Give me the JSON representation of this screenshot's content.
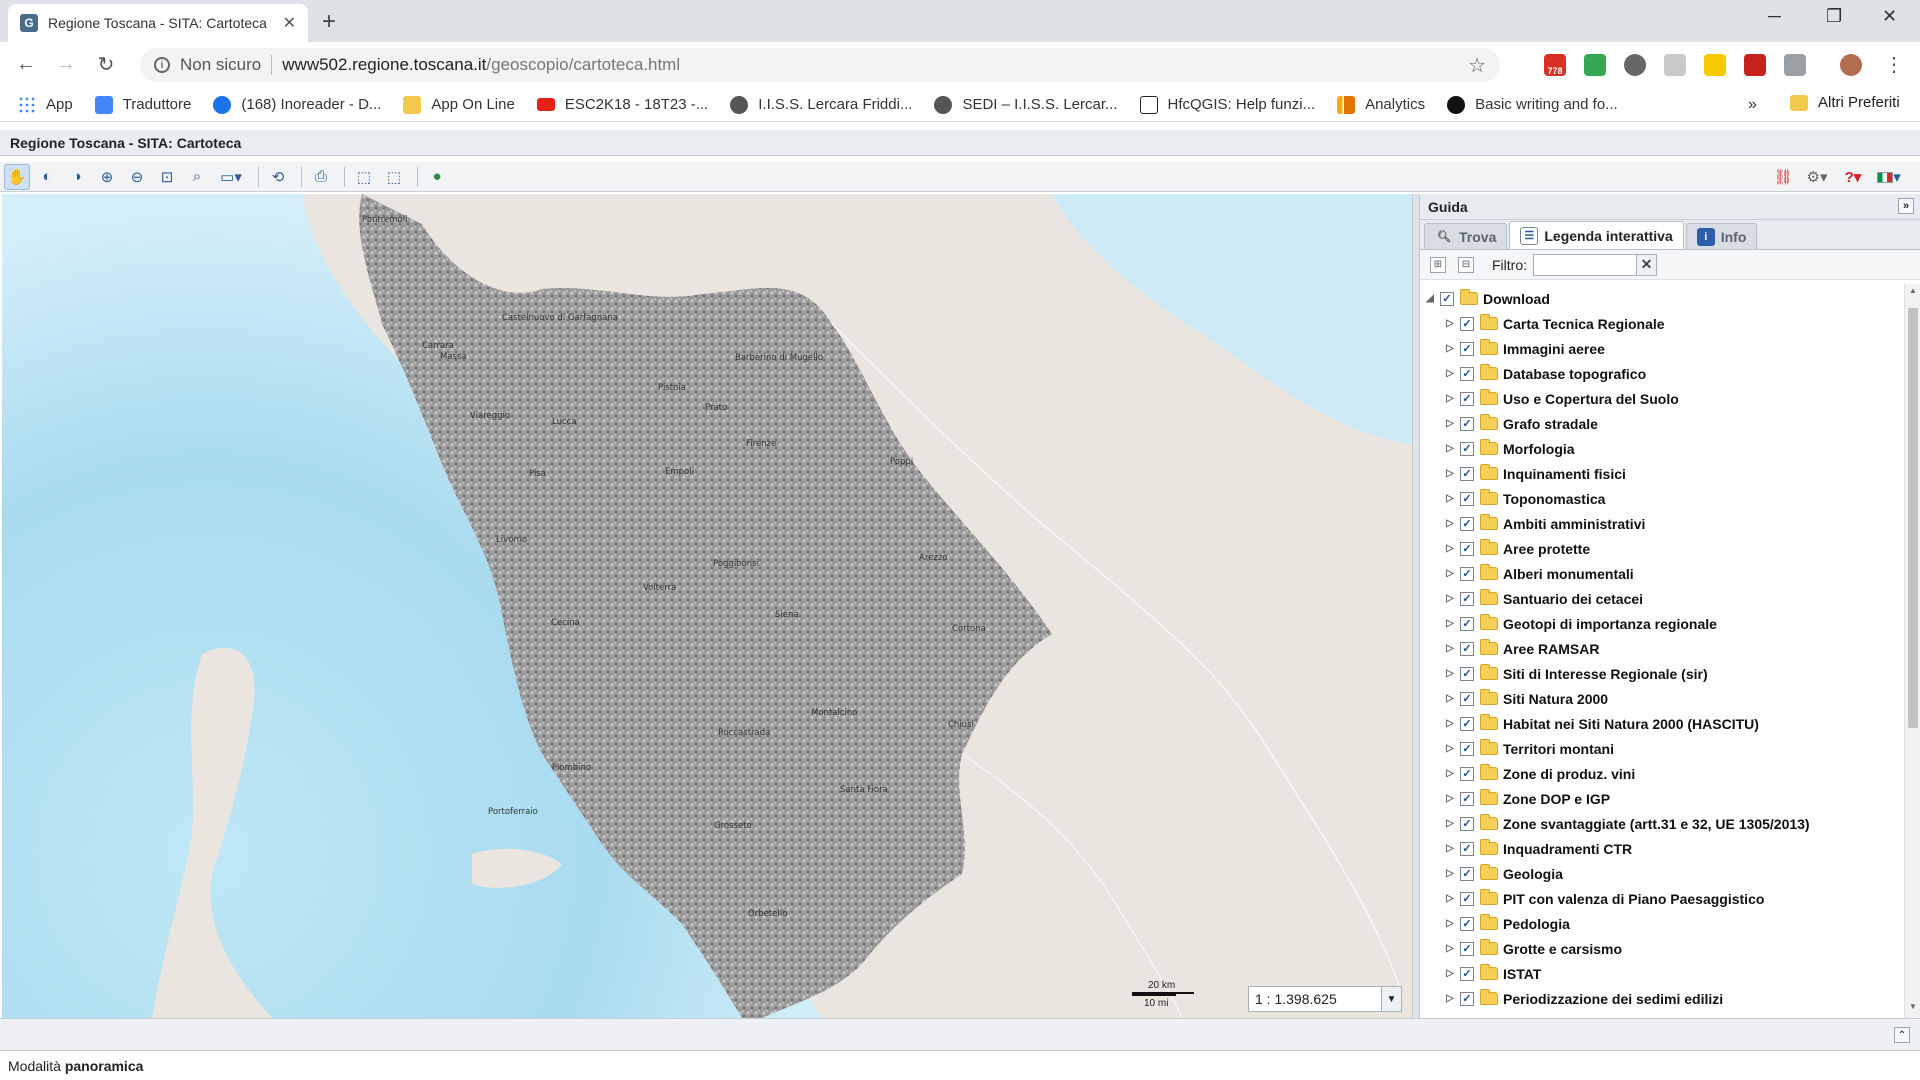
{
  "browser": {
    "tab_title": "Regione Toscana - SITA: Cartoteca",
    "tab_favicon": "G",
    "insecure_label": "Non sicuro",
    "url_host": "www502.regione.toscana.it",
    "url_path": "/geoscopio/cartoteca.html",
    "extension_badge": "778"
  },
  "bookmarks": [
    {
      "label": "App",
      "icon": "apps-grid-icon",
      "color": "#4285f4"
    },
    {
      "label": "Traduttore",
      "icon": "translate-icon",
      "color": "#4285f4"
    },
    {
      "label": "(168) Inoreader - D...",
      "icon": "inoreader-icon",
      "color": "#1a73e8"
    },
    {
      "label": "App On Line",
      "icon": "folder-icon",
      "color": "#f2c94c"
    },
    {
      "label": "ESC2K18 - 18T23 -...",
      "icon": "youtube-icon",
      "color": "#e62117"
    },
    {
      "label": "I.I.S.S. Lercara Friddi...",
      "icon": "globe-icon",
      "color": "#555555"
    },
    {
      "label": "SEDI – I.I.S.S. Lercar...",
      "icon": "globe-icon",
      "color": "#555555"
    },
    {
      "label": "HfcQGIS: Help funzi...",
      "icon": "hfc-icon",
      "color": "#222222"
    },
    {
      "label": "Analytics",
      "icon": "analytics-icon",
      "color": "#f9ab00"
    },
    {
      "label": "Basic writing and fo...",
      "icon": "github-icon",
      "color": "#111111"
    }
  ],
  "bookmarks_more": "»",
  "bookmarks_other": "Altri Preferiti",
  "app": {
    "title": "Regione Toscana - SITA: Cartoteca",
    "status_prefix": "Modalità",
    "status_mode": "panoramica"
  },
  "map": {
    "scale_km": "20 km",
    "scale_mi": "10 mi",
    "scale_value": "1 : 1.398.625",
    "places": [
      "Pontremoli",
      "Castelnuovo di Garfagnana",
      "Carrara",
      "Massa",
      "Barberino di Mugello",
      "Pistoia",
      "Prato",
      "Viareggio",
      "Lucca",
      "Firenze",
      "Poppi",
      "Pisa",
      "Empoli",
      "Livorno",
      "Poggibonsi",
      "Arezzo",
      "Volterra",
      "Siena",
      "Cecina",
      "Cortona",
      "Montalcino",
      "Chiusi",
      "Roccastrada",
      "Piombino",
      "Santa Fiora",
      "Portoferraio",
      "Grosseto",
      "Orbetello"
    ],
    "colors": {
      "land": "#eae6df",
      "sea": "#b9e3f2",
      "region": "#a6a6a6"
    }
  },
  "panel": {
    "title": "Guida",
    "tabs": [
      {
        "label": "Trova",
        "icon": "search-icon"
      },
      {
        "label": "Legenda interattiva",
        "icon": "legend-icon"
      },
      {
        "label": "Info",
        "icon": "info-icon"
      }
    ],
    "filter_label": "Filtro:",
    "filter_value": "",
    "root": "Download",
    "layers": [
      "Carta Tecnica Regionale",
      "Immagini aeree",
      "Database topografico",
      "Uso e Copertura del Suolo",
      "Grafo stradale",
      "Morfologia",
      "Inquinamenti fisici",
      "Toponomastica",
      "Ambiti amministrativi",
      "Aree protette",
      "Alberi monumentali",
      "Santuario dei cetacei",
      "Geotopi di importanza regionale",
      "Aree RAMSAR",
      "Siti di Interesse Regionale (sir)",
      "Siti Natura 2000",
      "Habitat nei Siti Natura 2000 (HASCITU)",
      "Territori montani",
      "Zone di produz. vini",
      "Zone DOP e IGP",
      "Zone svantaggiate (artt.31 e 32, UE 1305/2013)",
      "Inquadramenti CTR",
      "Geologia",
      "PIT con valenza di Piano Paesaggistico",
      "Pedologia",
      "Grotte e carsismo",
      "ISTAT",
      "Periodizzazione dei sedimi edilizi"
    ]
  }
}
